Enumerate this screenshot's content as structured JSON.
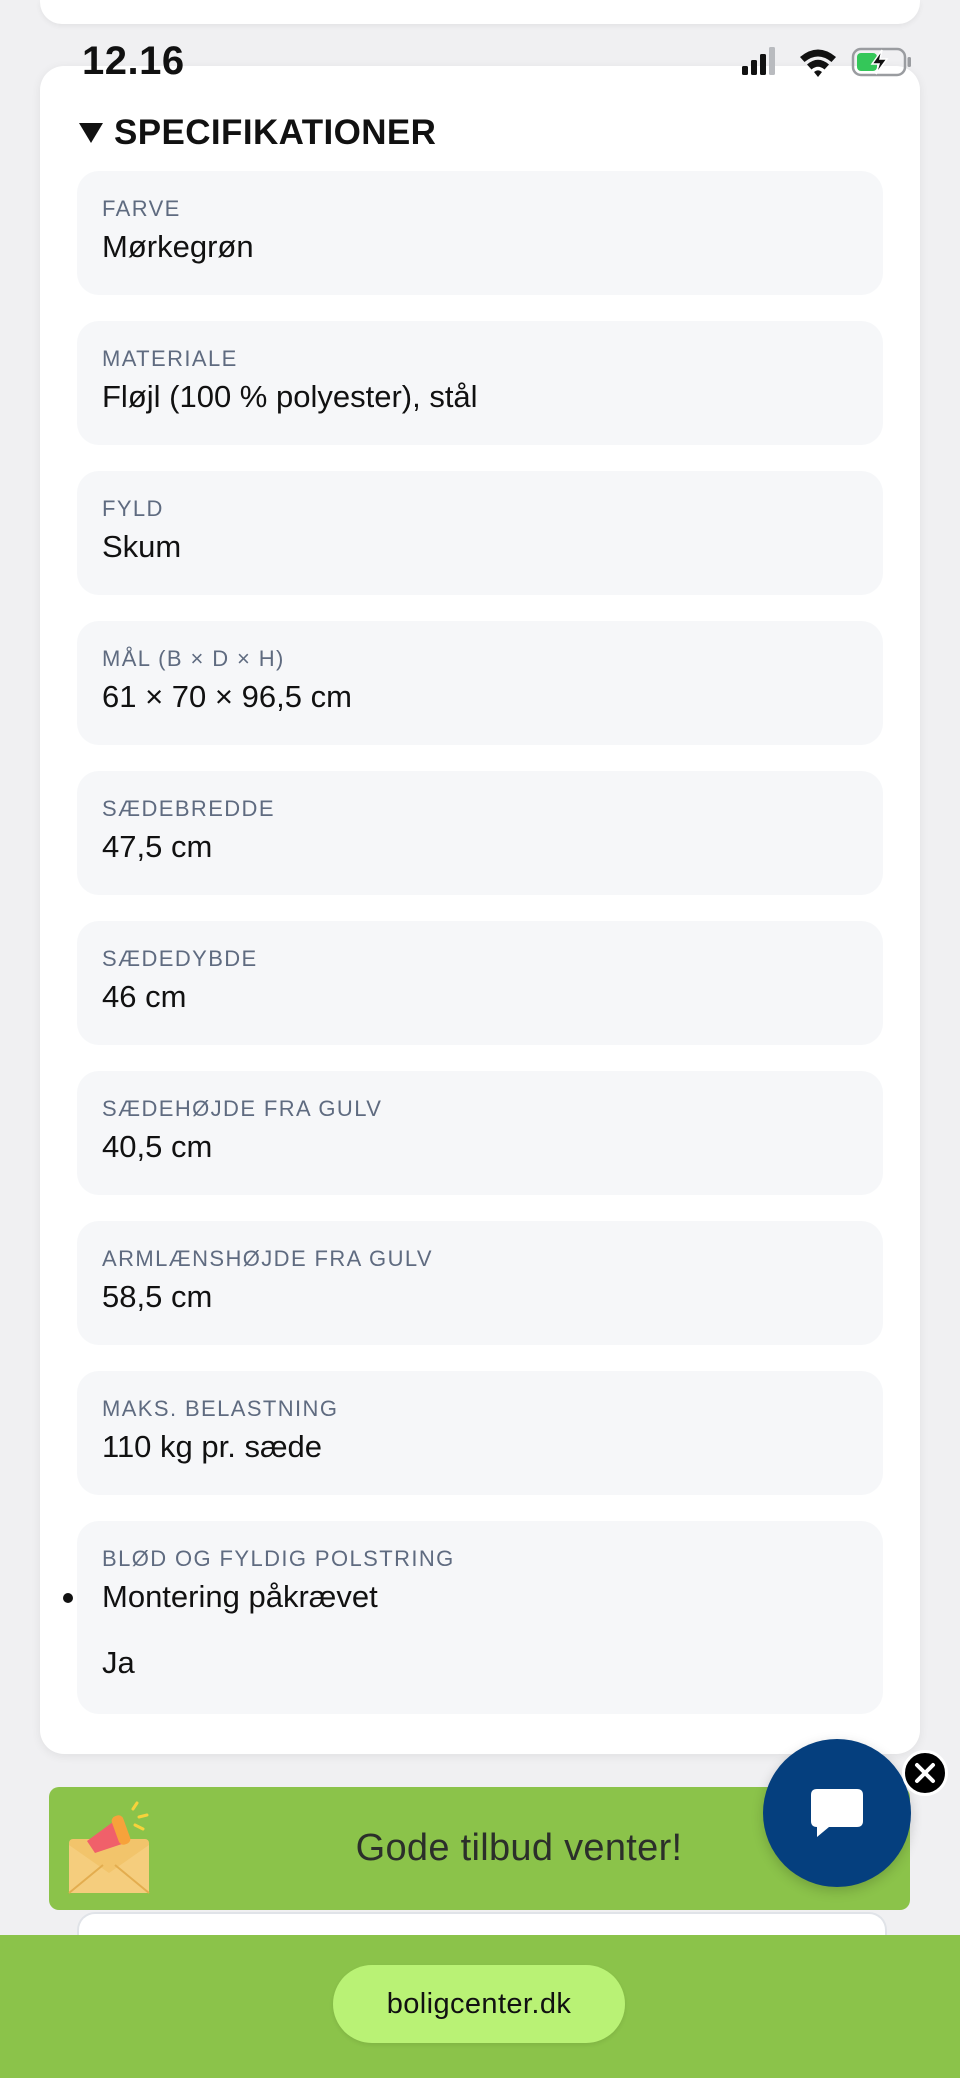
{
  "status_bar": {
    "time": "12.16"
  },
  "section": {
    "title": "SPECIFIKATIONER",
    "toggle_icon": "triangle-down-icon"
  },
  "specs": [
    {
      "label": "FARVE",
      "value": "Mørkegrøn"
    },
    {
      "label": "MATERIALE",
      "value": "Fløjl (100 % polyester), stål"
    },
    {
      "label": "FYLD",
      "value": "Skum"
    },
    {
      "label": "MÅL (B × D × H)",
      "value": "61 × 70 × 96,5 cm"
    },
    {
      "label": "SÆDEBREDDE",
      "value": "47,5 cm"
    },
    {
      "label": "SÆDEDYBDE",
      "value": "46 cm"
    },
    {
      "label": "SÆDEHØJDE FRA GULV",
      "value": "40,5 cm"
    },
    {
      "label": "ARMLÆNSHØJDE FRA GULV",
      "value": "58,5 cm"
    },
    {
      "label": "MAKS. BELASTNING",
      "value": "110 kg pr. sæde"
    }
  ],
  "last_spec": {
    "label": "BLØD OG FYLDIG POLSTRING",
    "bullet": "Montering påkrævet",
    "value": "Ja"
  },
  "promo": {
    "text": "Gode tilbud venter!",
    "icon": "megaphone-envelope-icon"
  },
  "chat": {
    "icon": "chat-bubble-icon",
    "close_icon": "close-icon"
  },
  "browser": {
    "url": "boligcenter.dk"
  },
  "colors": {
    "accent_green": "#8bc34a",
    "url_pill": "#b9f275",
    "chat_blue": "#053f7e",
    "label_gray": "#5f6b80",
    "card_bg": "#f6f7f9"
  }
}
